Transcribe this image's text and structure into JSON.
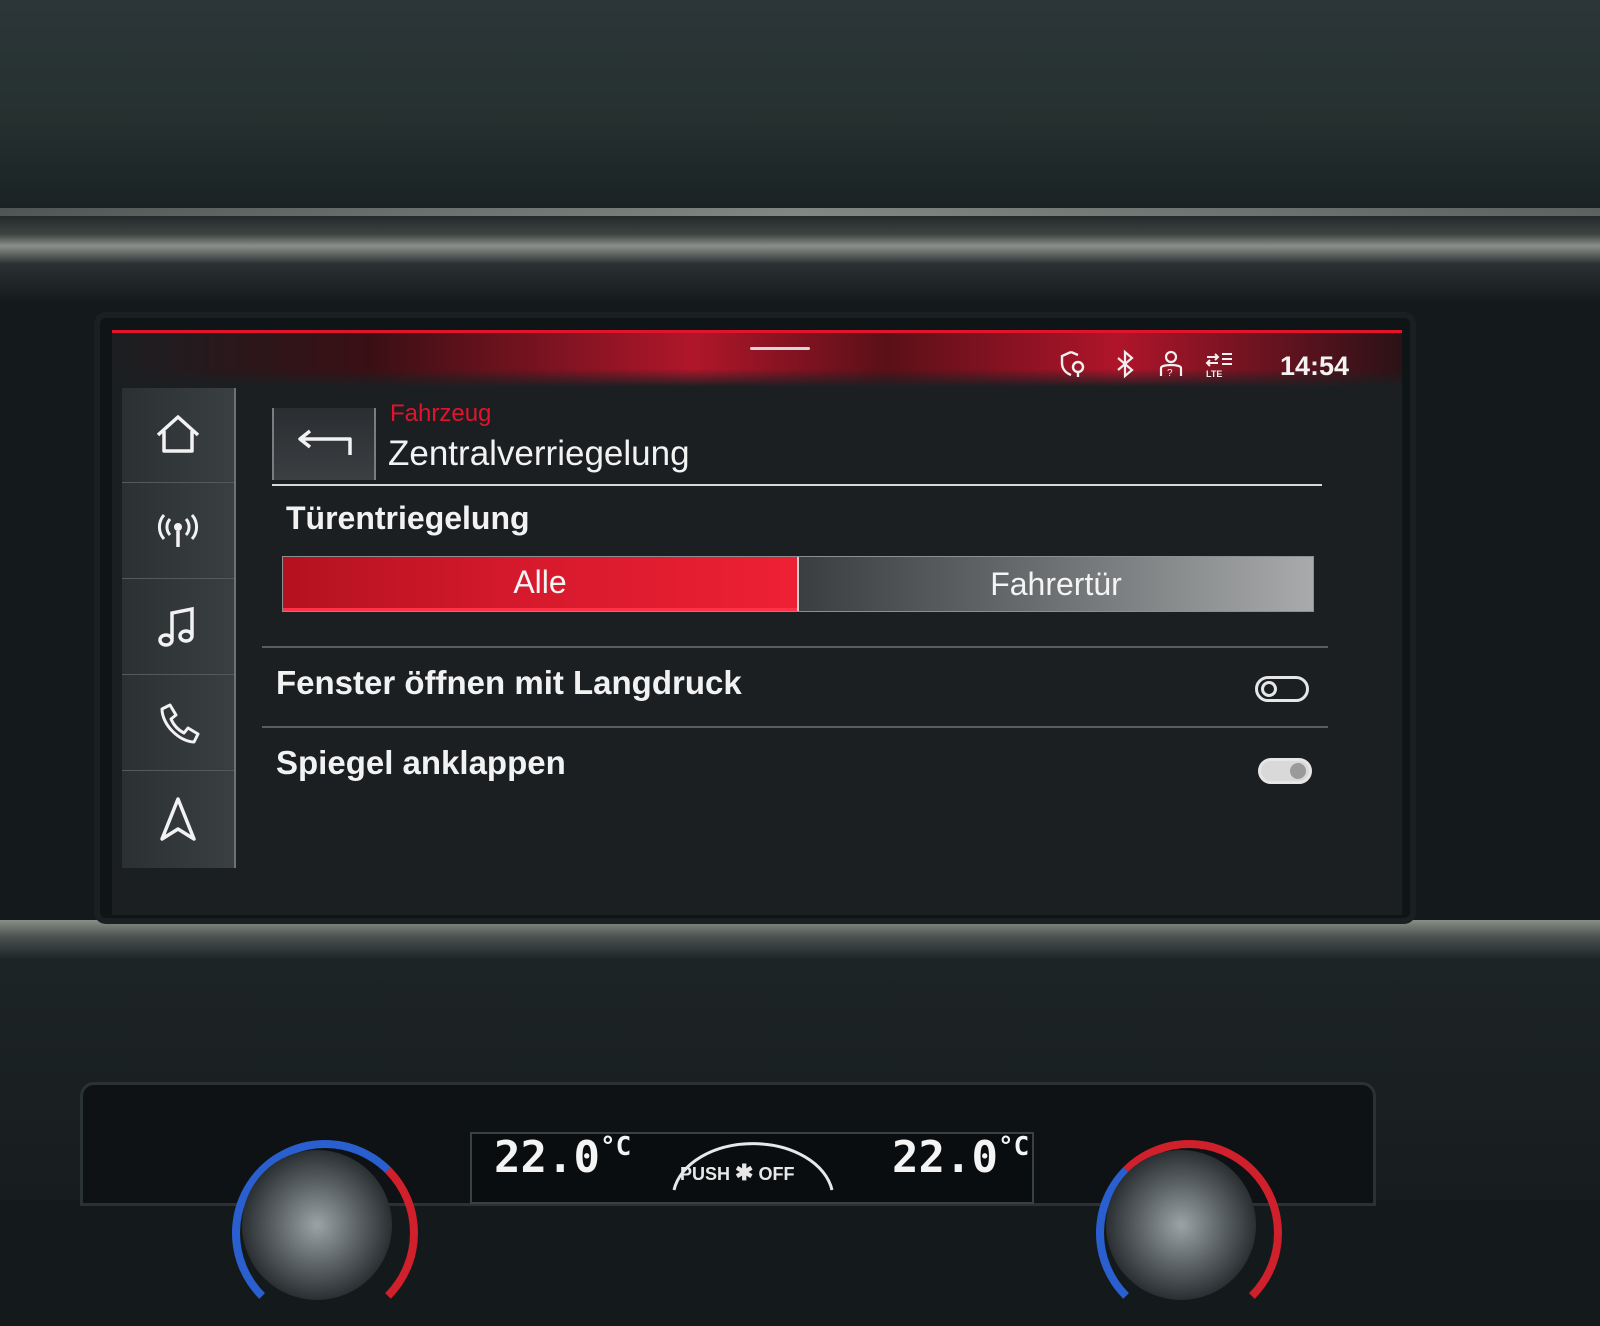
{
  "status_bar": {
    "time": "14:54",
    "icons": [
      "shield-location-icon",
      "bluetooth-icon",
      "user-profile-icon",
      "lte-data-icon"
    ]
  },
  "side_nav": {
    "items": [
      {
        "name": "home-icon"
      },
      {
        "name": "radio-icon"
      },
      {
        "name": "music-icon"
      },
      {
        "name": "phone-icon"
      },
      {
        "name": "navigation-icon"
      }
    ]
  },
  "header": {
    "breadcrumb": "Fahrzeug",
    "title": "Zentralverriegelung"
  },
  "unlock_section": {
    "title": "Türentriegelung",
    "options": [
      "Alle",
      "Fahrertür"
    ],
    "selected": "Alle"
  },
  "settings": [
    {
      "label": "Fenster öffnen mit Langdruck",
      "enabled": false
    },
    {
      "label": "Spiegel anklappen",
      "enabled": true
    }
  ],
  "climate": {
    "left_temp": "22.0",
    "right_temp": "22.0",
    "unit": "°C",
    "fan_label_left": "PUSH",
    "fan_label_right": "OFF"
  },
  "colors": {
    "accent": "#e2142c",
    "screen_bg": "#1b1f22",
    "text": "#f2f2f2"
  }
}
